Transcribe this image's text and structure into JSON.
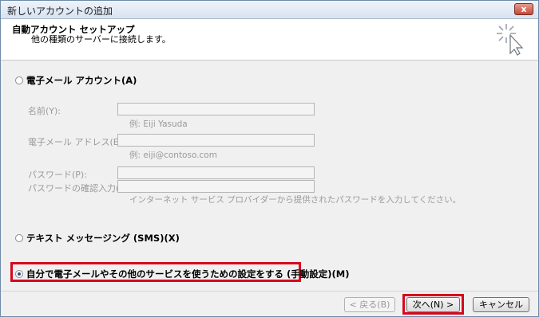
{
  "window": {
    "title": "新しいアカウントの追加",
    "close_label": "x"
  },
  "header": {
    "title": "自動アカウント セットアップ",
    "subtitle": "他の種類のサーバーに接続します。"
  },
  "options": {
    "email_account": "電子メール アカウント(A)",
    "sms": "テキスト メッセージング (SMS)(X)",
    "manual": "自分で電子メールやその他のサービスを使うための設定をする (手動設定)(M)",
    "selected": "manual"
  },
  "fields": {
    "name_label": "名前(Y):",
    "name_hint": "例: Eiji Yasuda",
    "email_label": "電子メール アドレス(E):",
    "email_hint": "例: eiji@contoso.com",
    "password_label": "パスワード(P):",
    "password_confirm_label": "パスワードの確認入力(T):",
    "password_hint": "インターネット サービス プロバイダーから提供されたパスワードを入力してください。"
  },
  "buttons": {
    "back": "< 戻る(B)",
    "next": "次へ(N) >",
    "cancel": "キャンセル"
  },
  "colors": {
    "highlight": "#d6081e",
    "title_bar": "#d7e3f1"
  }
}
